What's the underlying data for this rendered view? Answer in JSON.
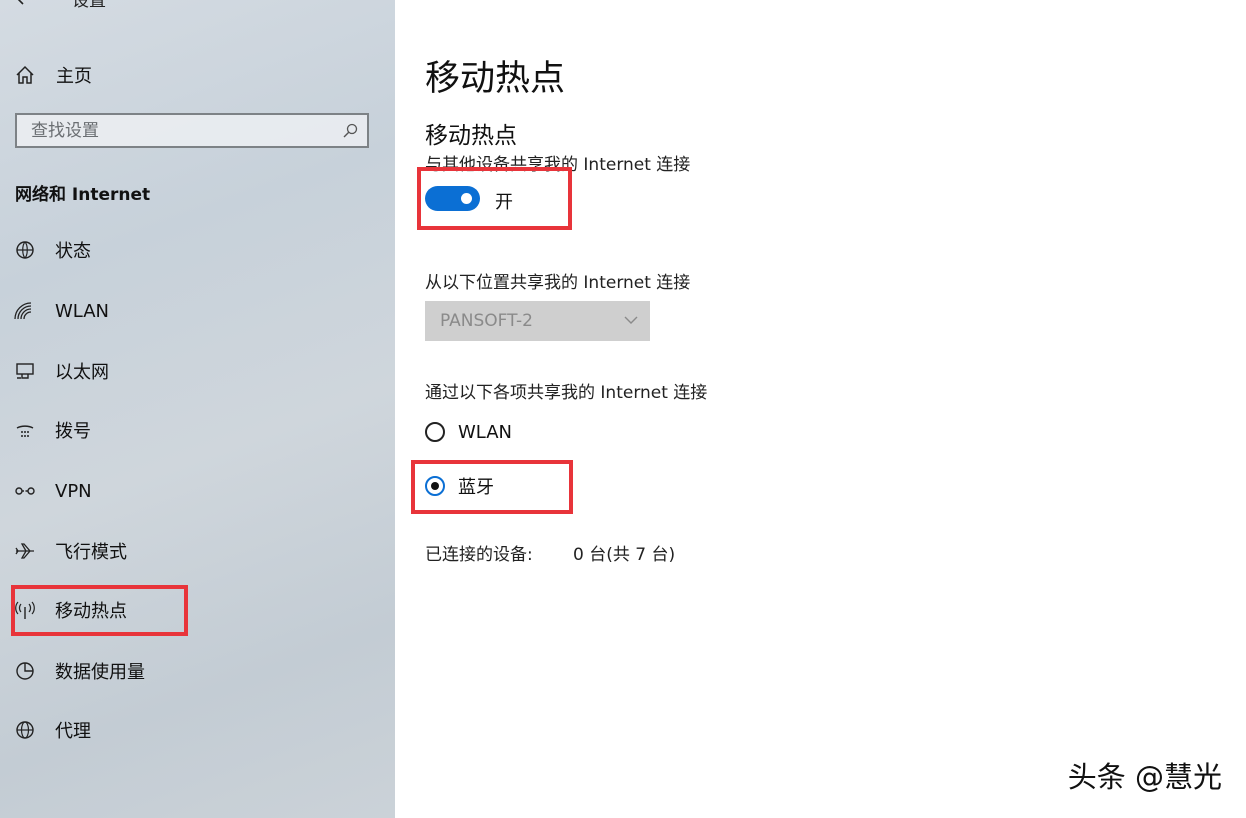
{
  "window": {
    "title": "设置"
  },
  "sidebar": {
    "home_label": "主页",
    "search_placeholder": "查找设置",
    "section_title": "网络和 Internet",
    "items": [
      {
        "label": "状态",
        "icon": "globe-status-icon"
      },
      {
        "label": "WLAN",
        "icon": "wifi-icon"
      },
      {
        "label": "以太网",
        "icon": "ethernet-icon"
      },
      {
        "label": "拨号",
        "icon": "dialup-icon"
      },
      {
        "label": "VPN",
        "icon": "vpn-icon"
      },
      {
        "label": "飞行模式",
        "icon": "airplane-icon"
      },
      {
        "label": "移动热点",
        "icon": "hotspot-icon",
        "selected": true
      },
      {
        "label": "数据使用量",
        "icon": "data-usage-icon"
      },
      {
        "label": "代理",
        "icon": "globe-icon"
      }
    ]
  },
  "main": {
    "page_title": "移动热点",
    "hotspot_title": "移动热点",
    "share_desc": "与其他设备共享我的 Internet 连接",
    "toggle": {
      "on": true,
      "label": "开"
    },
    "share_from_label": "从以下位置共享我的 Internet 连接",
    "share_from_value": "PANSOFT-2",
    "share_over_label": "通过以下各项共享我的 Internet 连接",
    "share_over_options": [
      {
        "label": "WLAN",
        "checked": false
      },
      {
        "label": "蓝牙",
        "checked": true
      }
    ],
    "connected_label": "已连接的设备:",
    "connected_value": "0 台(共 7 台)"
  },
  "watermark": "头条 @慧光",
  "colors": {
    "accent": "#0b6fd4",
    "highlight": "#e8343a",
    "sidebar_bg": "#c9d2da"
  }
}
